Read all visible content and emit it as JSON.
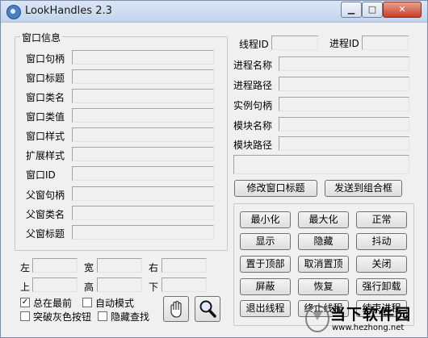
{
  "window": {
    "title": "LookHandles 2.3"
  },
  "window_info": {
    "group_label": "窗口信息",
    "rows": [
      {
        "label": "窗口句柄",
        "value": ""
      },
      {
        "label": "窗口标题",
        "value": ""
      },
      {
        "label": "窗口类名",
        "value": ""
      },
      {
        "label": "窗口类值",
        "value": ""
      },
      {
        "label": "窗口样式",
        "value": ""
      },
      {
        "label": "扩展样式",
        "value": ""
      },
      {
        "label": "窗口ID",
        "value": ""
      },
      {
        "label": "父窗句柄",
        "value": ""
      },
      {
        "label": "父窗类名",
        "value": ""
      },
      {
        "label": "父窗标题",
        "value": ""
      }
    ]
  },
  "position": {
    "left_label": "左",
    "width_label": "宽",
    "right_label": "右",
    "top_label": "上",
    "height_label": "高",
    "bottom_label": "下"
  },
  "options": {
    "always_on_top": {
      "label": "总在最前",
      "checked": true
    },
    "auto_mode": {
      "label": "自动模式",
      "checked": false
    },
    "break_grey_button": {
      "label": "突破灰色按钮",
      "checked": false
    },
    "hidden_search": {
      "label": "隐藏查找",
      "checked": false
    }
  },
  "process_info": {
    "thread_id_label": "线程ID",
    "process_id_label": "进程ID",
    "rows": [
      {
        "label": "进程名称",
        "value": ""
      },
      {
        "label": "进程路径",
        "value": ""
      },
      {
        "label": "实例句柄",
        "value": ""
      },
      {
        "label": "模块名称",
        "value": ""
      },
      {
        "label": "模块路径",
        "value": ""
      }
    ]
  },
  "actions": {
    "modify_title": "修改窗口标题",
    "send_to_combo": "发送到组合框",
    "minimize": "最小化",
    "maximize": "最大化",
    "normal": "正常",
    "show": "显示",
    "hide": "隐藏",
    "shake": "抖动",
    "set_top": "置于顶部",
    "unset_top": "取消置顶",
    "close": "关闭",
    "mask": "屏蔽",
    "restore": "恢复",
    "force_unload": "强行卸载",
    "exit_thread": "退出线程",
    "terminate_thread": "终止线程",
    "end_process": "结束进程"
  },
  "watermark": {
    "text": "当下软件园",
    "url": "www.hezhong.net"
  }
}
